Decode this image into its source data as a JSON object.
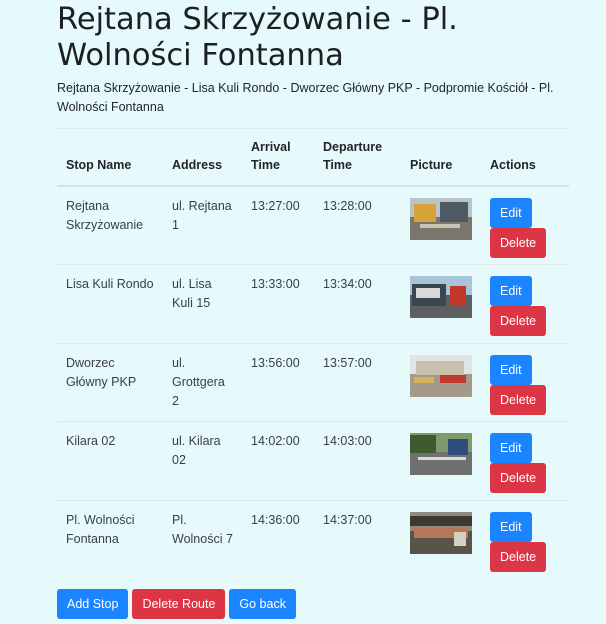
{
  "page": {
    "title": "Rejtana Skrzyżowanie - Pl. Wolności Fontanna",
    "route_description": "Rejtana Skrzyżowanie - Lisa Kuli Rondo - Dworzec Główny PKP - Podpromie Kościół - Pl. Wolności Fontanna"
  },
  "table": {
    "headers": {
      "stop_name": "Stop Name",
      "address": "Address",
      "arrival": "Arrival Time",
      "departure": "Departure Time",
      "picture": "Picture",
      "actions": "Actions"
    },
    "rows": [
      {
        "stop_name": "Rejtana Skrzyżowanie",
        "address": "ul. Rejtana 1",
        "arrival": "13:27:00",
        "departure": "13:28:00",
        "edit": "Edit",
        "delete": "Delete"
      },
      {
        "stop_name": "Lisa Kuli Rondo",
        "address": "ul. Lisa Kuli 15",
        "arrival": "13:33:00",
        "departure": "13:34:00",
        "edit": "Edit",
        "delete": "Delete"
      },
      {
        "stop_name": "Dworzec Główny PKP",
        "address": "ul. Grottgera 2",
        "arrival": "13:56:00",
        "departure": "13:57:00",
        "edit": "Edit",
        "delete": "Delete"
      },
      {
        "stop_name": "Kilara 02",
        "address": "ul. Kilara 02",
        "arrival": "14:02:00",
        "departure": "14:03:00",
        "edit": "Edit",
        "delete": "Delete"
      },
      {
        "stop_name": "Pl. Wolności Fontanna",
        "address": "Pl. Wolności 7",
        "arrival": "14:36:00",
        "departure": "14:37:00",
        "edit": "Edit",
        "delete": "Delete"
      }
    ]
  },
  "buttons": {
    "add_stop": "Add Stop",
    "delete_route": "Delete Route",
    "go_back": "Go back"
  },
  "colors": {
    "background": "#e6fafc",
    "primary": "#1a85ff",
    "danger": "#dc3545"
  }
}
